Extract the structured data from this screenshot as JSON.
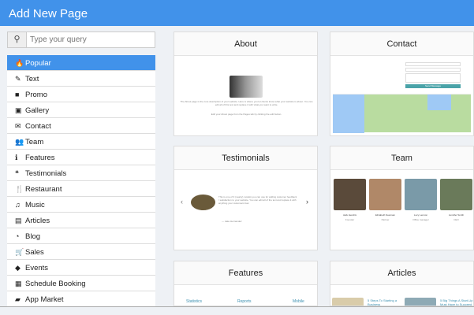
{
  "header": {
    "title": "Add New Page"
  },
  "search": {
    "placeholder": "Type your query"
  },
  "categories": [
    {
      "label": "Popular",
      "icon": "fire-icon",
      "glyph": "🔥"
    },
    {
      "label": "Text",
      "icon": "edit-icon",
      "glyph": "✎"
    },
    {
      "label": "Promo",
      "icon": "square-icon",
      "glyph": "■"
    },
    {
      "label": "Gallery",
      "icon": "image-icon",
      "glyph": "▣"
    },
    {
      "label": "Contact",
      "icon": "envelope-icon",
      "glyph": "✉"
    },
    {
      "label": "Team",
      "icon": "users-icon",
      "glyph": "👥"
    },
    {
      "label": "Features",
      "icon": "info-icon",
      "glyph": "ℹ"
    },
    {
      "label": "Testimonials",
      "icon": "comments-icon",
      "glyph": "❝"
    },
    {
      "label": "Restaurant",
      "icon": "cutlery-icon",
      "glyph": "🍴"
    },
    {
      "label": "Music",
      "icon": "music-icon",
      "glyph": "♫"
    },
    {
      "label": "Articles",
      "icon": "file-icon",
      "glyph": "▤"
    },
    {
      "label": "Blog",
      "icon": "rss-icon",
      "glyph": "◔"
    },
    {
      "label": "Sales",
      "icon": "cart-icon",
      "glyph": "🛒"
    },
    {
      "label": "Events",
      "icon": "ticket-icon",
      "glyph": "◆"
    },
    {
      "label": "Schedule Booking",
      "icon": "calendar-icon",
      "glyph": "▦"
    },
    {
      "label": "App Market",
      "icon": "bag-icon",
      "glyph": "▰"
    }
  ],
  "cards": {
    "about": {
      "title": "About",
      "text": "The About page is the core description of your website. Here is where you let clients know what your website is about. You can edit all of this text and replace it with what you want to write.",
      "text2": "Edit your About page from the Pages tab by clicking the edit button."
    },
    "contact": {
      "title": "Contact",
      "button": "Send Message"
    },
    "testimonials": {
      "title": "Testimonials",
      "quote": "This is one of 3 (nearly) models you can use for adding customer feedback / satisfaction to your website. You can edit all of the text and replace it with anything your customers feel.",
      "author": "— Jake Hernandez"
    },
    "team": {
      "title": "Team",
      "members": [
        {
          "name": "Jack Hendrix",
          "role": "Founder"
        },
        {
          "name": "Elizabeth Newman",
          "role": "Partner"
        },
        {
          "name": "Lucy Lennon",
          "role": "Office manager"
        },
        {
          "name": "Jennifer Smith",
          "role": "CEO"
        }
      ]
    },
    "features": {
      "title": "Features",
      "items": [
        "Statistics",
        "Reports",
        "Mobile"
      ]
    },
    "articles": {
      "title": "Articles",
      "items": [
        "5 Steps To Starting a Business",
        "5 Big Things A Start-Up Must Have to Succeed"
      ]
    }
  },
  "colors": {
    "accent": "#4192ea"
  }
}
